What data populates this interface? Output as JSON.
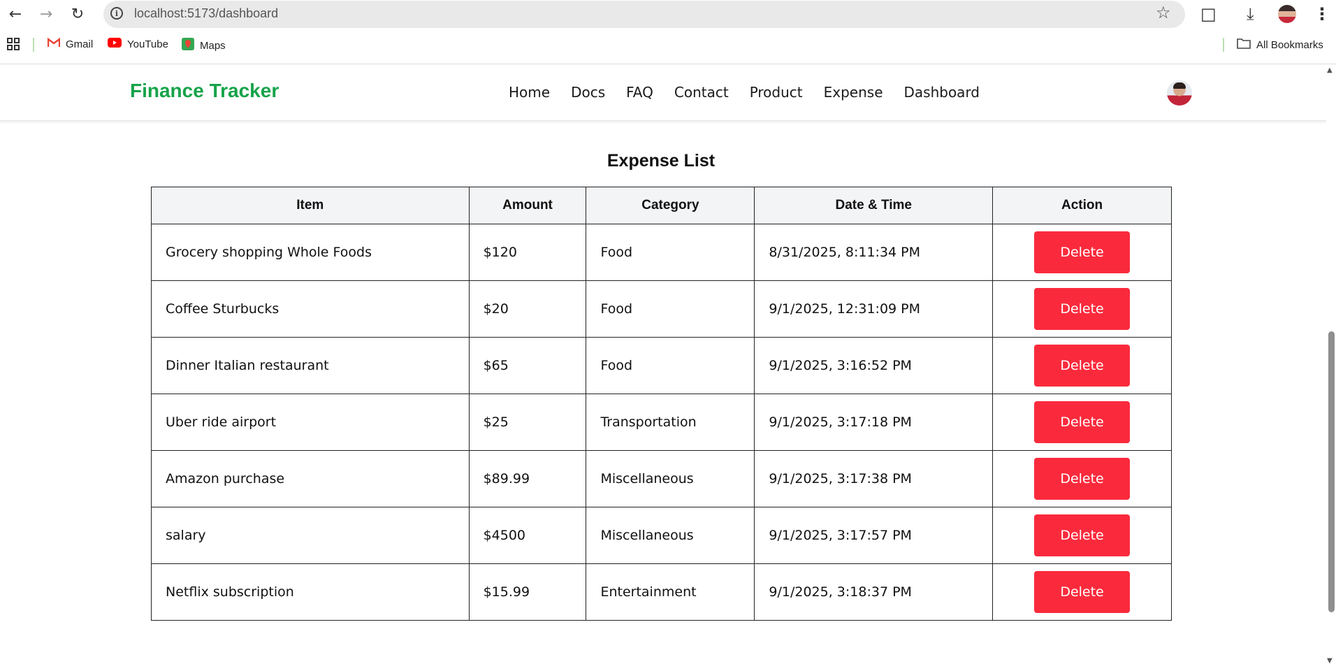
{
  "browser": {
    "url": "localhost:5173/dashboard",
    "bookmarks": [
      {
        "label": "Gmail",
        "icon": "gmail-icon"
      },
      {
        "label": "YouTube",
        "icon": "youtube-icon"
      },
      {
        "label": "Maps",
        "icon": "maps-icon"
      }
    ],
    "all_bookmarks": "All Bookmarks"
  },
  "site": {
    "brand": "Finance Tracker",
    "brand_color": "#16a34a",
    "menu": [
      "Home",
      "Docs",
      "FAQ",
      "Contact",
      "Product",
      "Expense",
      "Dashboard"
    ]
  },
  "expense_list": {
    "title": "Expense List",
    "columns": [
      "Item",
      "Amount",
      "Category",
      "Date & Time",
      "Action"
    ],
    "delete_label": "Delete",
    "delete_color": "#fa2a3c",
    "rows": [
      {
        "item": "Grocery shopping Whole Foods",
        "amount": "$120",
        "category": "Food",
        "datetime": "8/31/2025, 8:11:34 PM"
      },
      {
        "item": "Coffee Sturbucks",
        "amount": "$20",
        "category": "Food",
        "datetime": "9/1/2025, 12:31:09 PM"
      },
      {
        "item": "Dinner Italian restaurant",
        "amount": "$65",
        "category": "Food",
        "datetime": "9/1/2025, 3:16:52 PM"
      },
      {
        "item": "Uber ride airport",
        "amount": "$25",
        "category": "Transportation",
        "datetime": "9/1/2025, 3:17:18 PM"
      },
      {
        "item": "Amazon purchase",
        "amount": "$89.99",
        "category": "Miscellaneous",
        "datetime": "9/1/2025, 3:17:38 PM"
      },
      {
        "item": "salary",
        "amount": "$4500",
        "category": "Miscellaneous",
        "datetime": "9/1/2025, 3:17:57 PM"
      },
      {
        "item": "Netflix subscription",
        "amount": "$15.99",
        "category": "Entertainment",
        "datetime": "9/1/2025, 3:18:37 PM"
      }
    ]
  }
}
